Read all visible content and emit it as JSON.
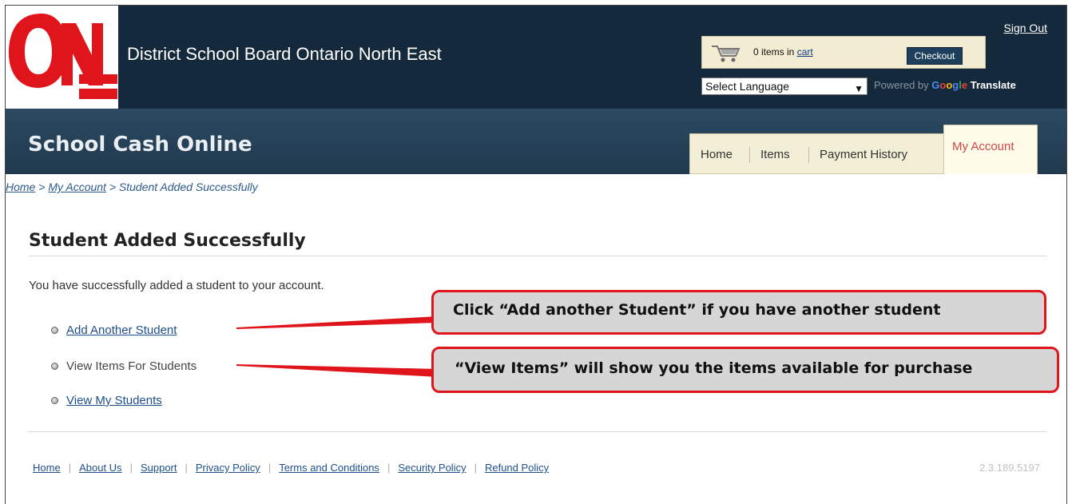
{
  "header": {
    "board_title": "District School Board Ontario North East",
    "sign_out": "Sign Out",
    "cart": {
      "count_text": "0 items in ",
      "cart_link": "cart",
      "checkout": "Checkout"
    },
    "language": {
      "selected": "Select Language",
      "powered_by": "Powered by ",
      "google_letters": [
        "G",
        "o",
        "o",
        "g",
        "l",
        "e"
      ],
      "translate": "Translate"
    }
  },
  "nav": {
    "app_title": "School Cash Online",
    "tabs": [
      "Home",
      "Items",
      "Payment History"
    ],
    "active_tab": "My Account"
  },
  "breadcrumb": {
    "home": "Home",
    "sep1": " > ",
    "account": "My Account",
    "sep2": " > ",
    "current": "Student Added Successfully"
  },
  "main": {
    "title": "Student Added Successfully",
    "intro": "You have successfully added a student to your account.",
    "links": [
      "Add Another Student",
      "View Items For Students",
      "View My Students"
    ]
  },
  "callouts": [
    "Click “Add another Student” if you have another student",
    "“View Items” will show you the items available for purchase"
  ],
  "footer": {
    "links": [
      "Home",
      "About Us",
      "Support",
      "Privacy Policy",
      "Terms and Conditions",
      "Security Policy",
      "Refund Policy"
    ],
    "separator": "|",
    "version": "2.3.189.5197"
  },
  "colors": {
    "header_bg": "#14293b",
    "band_bg": "#2c4a62",
    "logo_red": "#e0141b",
    "callout_border": "#e0141b",
    "link": "#1d4f8a"
  }
}
